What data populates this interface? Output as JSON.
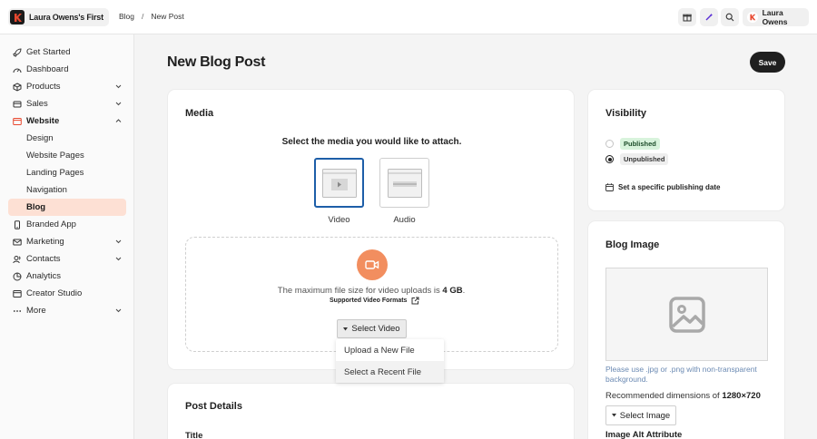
{
  "brand": {
    "name": "Laura Owens's First"
  },
  "breadcrumb": {
    "section": "Blog",
    "separator": "/",
    "current": "New Post"
  },
  "user": {
    "name": "Laura Owens"
  },
  "sidebar": {
    "items": [
      {
        "label": "Get Started",
        "icon": "rocket-icon"
      },
      {
        "label": "Dashboard",
        "icon": "dashboard-icon"
      },
      {
        "label": "Products",
        "icon": "box-icon",
        "chevron": "down"
      },
      {
        "label": "Sales",
        "icon": "sales-icon",
        "chevron": "down"
      },
      {
        "label": "Website",
        "icon": "website-icon",
        "chevron": "up",
        "active": true
      },
      {
        "label": "Design",
        "sub": true
      },
      {
        "label": "Website Pages",
        "sub": true
      },
      {
        "label": "Landing Pages",
        "sub": true
      },
      {
        "label": "Navigation",
        "sub": true
      },
      {
        "label": "Blog",
        "sub": true,
        "selected": true
      },
      {
        "label": "Branded App",
        "icon": "phone-icon"
      },
      {
        "label": "Marketing",
        "icon": "mail-icon",
        "chevron": "down"
      },
      {
        "label": "Contacts",
        "icon": "contacts-icon",
        "chevron": "down"
      },
      {
        "label": "Analytics",
        "icon": "analytics-icon"
      },
      {
        "label": "Creator Studio",
        "icon": "studio-icon"
      },
      {
        "label": "More",
        "icon": "more-icon",
        "chevron": "down"
      }
    ]
  },
  "page": {
    "title": "New Blog Post",
    "save_label": "Save"
  },
  "media": {
    "title": "Media",
    "heading": "Select the media you would like to attach.",
    "video_label": "Video",
    "audio_label": "Audio",
    "max_size_prefix": "The maximum file size for video uploads is",
    "max_size_value": "4 GB",
    "max_size_suffix": ".",
    "formats_label": "Supported Video Formats",
    "select_video_label": "Select Video",
    "menu": [
      "Upload a New File",
      "Select a Recent File"
    ]
  },
  "post_details": {
    "title": "Post Details",
    "title_label": "Title"
  },
  "visibility": {
    "title": "Visibility",
    "published": "Published",
    "unpublished": "Unpublished",
    "selected": "Unpublished",
    "schedule_label": "Set a specific publishing date"
  },
  "blog_image": {
    "title": "Blog Image",
    "hint": "Please use .jpg or .png with non-transparent background.",
    "rec_prefix": "Recommended dimensions of",
    "rec_value": "1280×720",
    "select_label": "Select Image",
    "alt_label": "Image Alt Attribute"
  },
  "colors": {
    "accent": "#f28e5f",
    "selected_nav": "#fde0d4",
    "selected_border": "#1d5ea8",
    "published_badge": "#d8f3dc",
    "hint_text": "#6b8ab3"
  }
}
